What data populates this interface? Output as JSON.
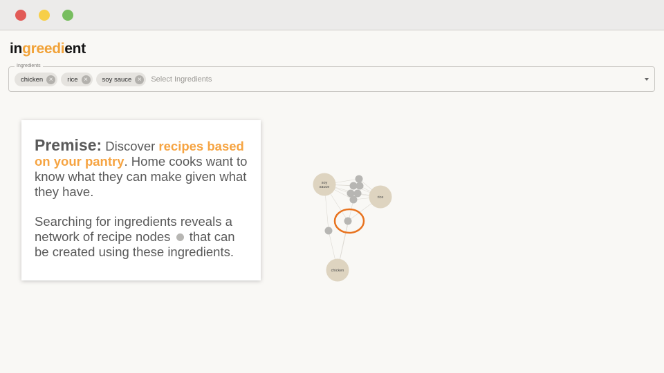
{
  "app": {
    "logo_parts": [
      "in",
      "greedi",
      "ent"
    ],
    "brand_color": "#f1a238"
  },
  "window": {
    "controls": [
      "close",
      "minimize",
      "maximize"
    ]
  },
  "ingredients_field": {
    "legend": "Ingredients",
    "chips": [
      "chicken",
      "rice",
      "soy sauce"
    ],
    "placeholder": "Select Ingredients",
    "remove_icon": "cancel-circle-icon",
    "dropdown_icon": "caret-down-icon"
  },
  "card": {
    "premise_label": "Premise:",
    "text_1": " Discover ",
    "highlight": "recipes based on your pantry",
    "text_2": ". Home cooks want to know what they can make given what they have.",
    "p2_before": "Searching for ingredients reveals a network of recipe nodes",
    "p2_after": " that can be created using these ingredients.",
    "highlight_color": "#f6a442"
  },
  "graph": {
    "ingredient_nodes": [
      {
        "label": "soy sauce",
        "id": "soy-sauce"
      },
      {
        "label": "rice",
        "id": "rice"
      },
      {
        "label": "chicken",
        "id": "chicken"
      }
    ],
    "recipe_node_count": 10,
    "ingredient_color": "#ded4c0",
    "recipe_color": "#b7b6b3",
    "highlight_ring_color": "#e8731f"
  }
}
